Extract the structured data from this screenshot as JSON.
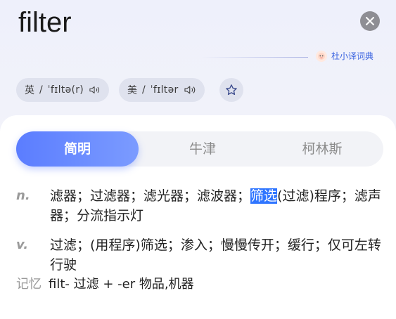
{
  "header": {
    "word": "filter",
    "brand_name": "杜小译词典"
  },
  "pronunciations": [
    {
      "region": "英",
      "ipa": "ˈfɪltə(r)"
    },
    {
      "region": "美",
      "ipa": "ˈfɪltər"
    }
  ],
  "tabs": [
    {
      "label": "简明",
      "active": true
    },
    {
      "label": "牛津",
      "active": false
    },
    {
      "label": "柯林斯",
      "active": false
    }
  ],
  "definitions": [
    {
      "pos": "n.",
      "before": "滤器；过滤器；滤光器；滤波器；",
      "highlight": "筛选",
      "after": "(过滤)程序；滤声器；分流指示灯"
    },
    {
      "pos": "v.",
      "text": "过滤；(用程序)筛选；渗入；慢慢传开；缓行；仅可左转行驶"
    }
  ],
  "memory": {
    "label": "记忆",
    "text": "filt- 过滤 + -er 物品,机器"
  },
  "colors": {
    "accent": "#5b7dff",
    "selection": "#2f75ff",
    "brand_text": "#3a63e0"
  }
}
